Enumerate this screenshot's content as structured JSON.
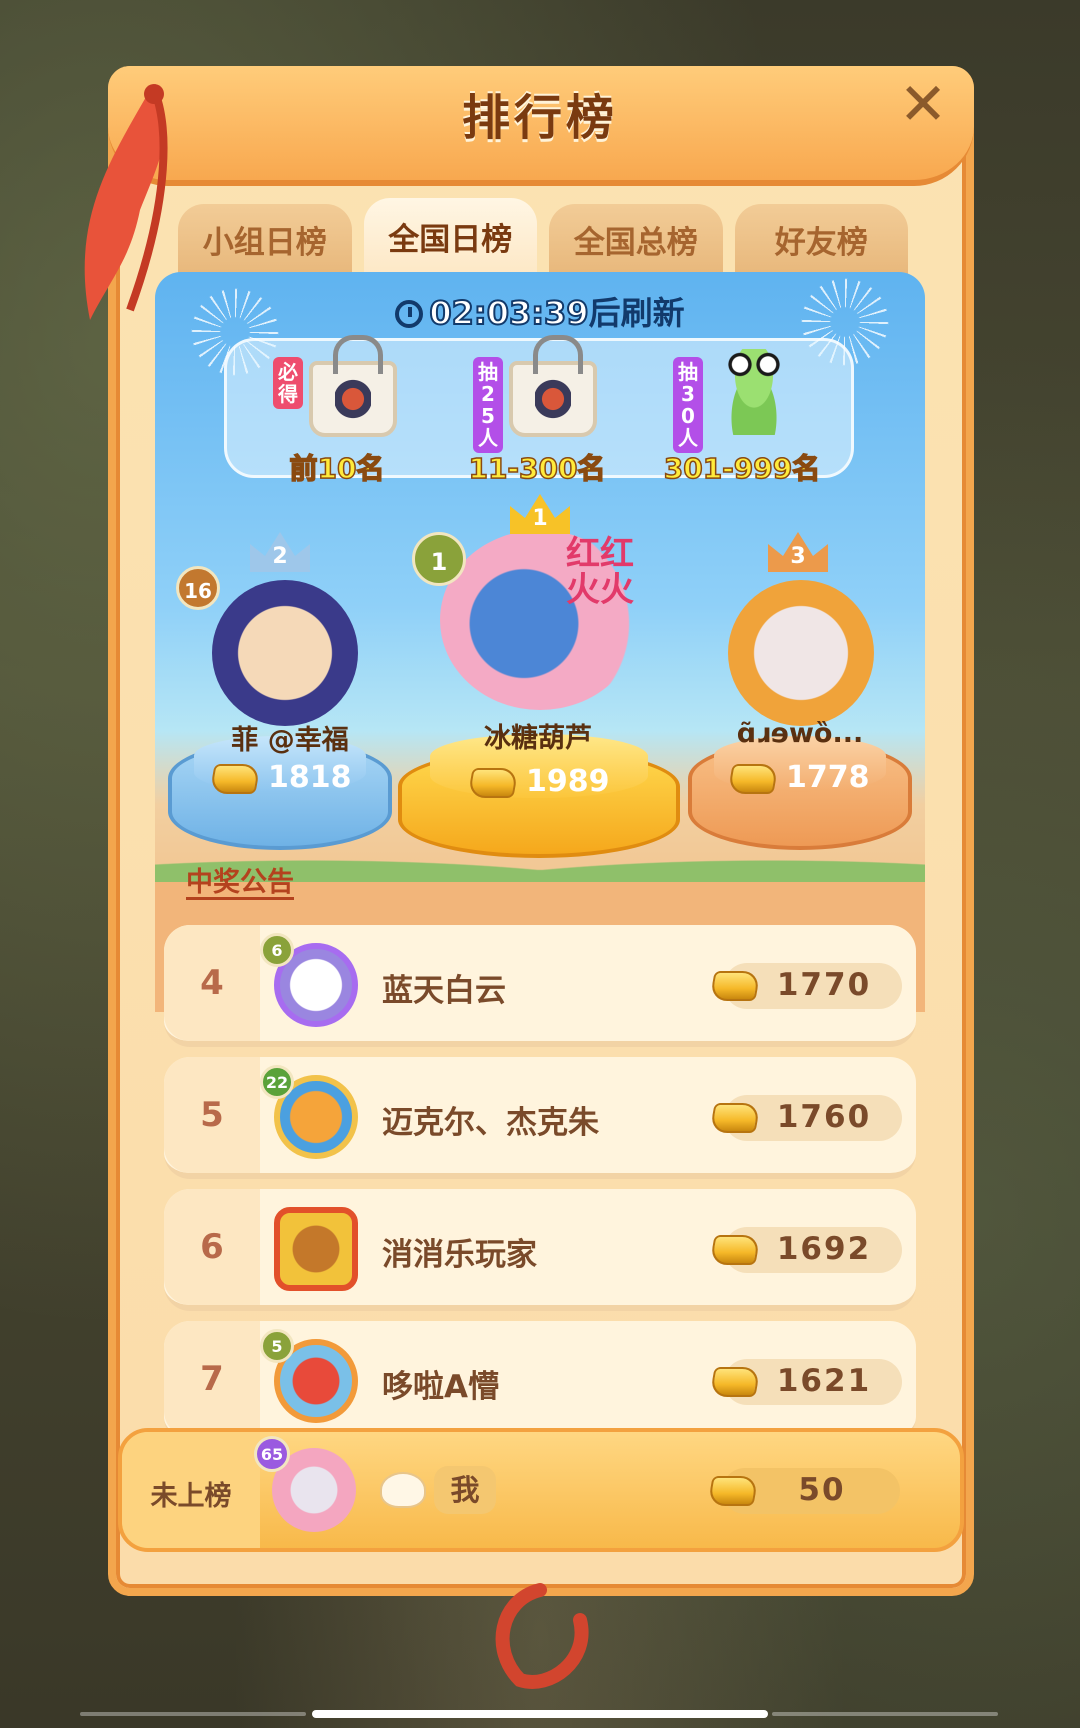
{
  "header": {
    "title": "排行榜",
    "close_icon": "close-icon"
  },
  "tabs": [
    {
      "label": "小组日榜",
      "active": false
    },
    {
      "label": "全国日榜",
      "active": true
    },
    {
      "label": "全国总榜",
      "active": false
    },
    {
      "label": "好友榜",
      "active": false
    }
  ],
  "timer": {
    "countdown": "02:03:39",
    "suffix": "后刷新"
  },
  "rewards": [
    {
      "tag": "必得",
      "label": "前10名",
      "tag_color": "#ee4d6e",
      "icon": "gift-bag-icon"
    },
    {
      "tag": "抽25人",
      "label": "11-300名",
      "tag_color": "#b34fe8",
      "icon": "gift-bag-icon"
    },
    {
      "tag": "抽30人",
      "label": "301-999名",
      "tag_color": "#b34fe8",
      "icon": "frog-plush-icon"
    }
  ],
  "podium": {
    "first": {
      "rank": "1",
      "level": "1",
      "name": "冰糖葫芦",
      "score": "1989"
    },
    "second": {
      "rank": "2",
      "level": "16",
      "name": "菲 @幸福",
      "score": "1818"
    },
    "third": {
      "rank": "3",
      "name": "ɑ̃ɹɘwȍ...",
      "score": "1778"
    }
  },
  "announcement": "中奖公告",
  "list": [
    {
      "rank": "4",
      "level": "6",
      "name": "蓝天白云",
      "score": "1770"
    },
    {
      "rank": "5",
      "level": "22",
      "name": "迈克尔、杰克朱",
      "score": "1760"
    },
    {
      "rank": "6",
      "level": "",
      "name": "消消乐玩家",
      "score": "1692"
    },
    {
      "rank": "7",
      "level": "5",
      "name": "哆啦A懵",
      "score": "1621"
    }
  ],
  "me": {
    "rank_text": "未上榜",
    "level": "65",
    "name": "我",
    "score": "50"
  },
  "colors": {
    "gold": "#f5b828",
    "panel": "#fbe3b2",
    "accent": "#f3a64d"
  }
}
